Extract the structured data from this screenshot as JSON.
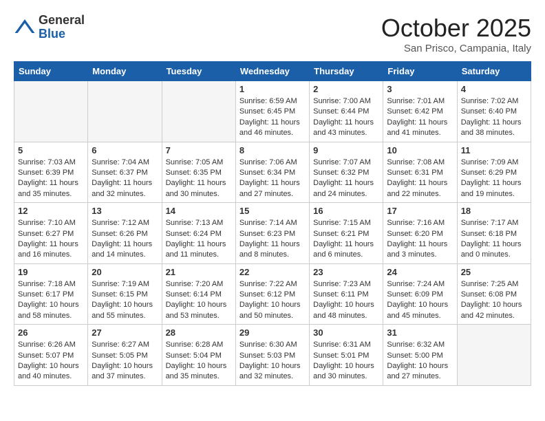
{
  "header": {
    "logo_general": "General",
    "logo_blue": "Blue",
    "month_title": "October 2025",
    "location": "San Prisco, Campania, Italy"
  },
  "days_of_week": [
    "Sunday",
    "Monday",
    "Tuesday",
    "Wednesday",
    "Thursday",
    "Friday",
    "Saturday"
  ],
  "weeks": [
    [
      {
        "day": "",
        "content": "",
        "empty": true
      },
      {
        "day": "",
        "content": "",
        "empty": true
      },
      {
        "day": "",
        "content": "",
        "empty": true
      },
      {
        "day": "1",
        "content": "Sunrise: 6:59 AM\nSunset: 6:45 PM\nDaylight: 11 hours\nand 46 minutes.",
        "empty": false
      },
      {
        "day": "2",
        "content": "Sunrise: 7:00 AM\nSunset: 6:44 PM\nDaylight: 11 hours\nand 43 minutes.",
        "empty": false
      },
      {
        "day": "3",
        "content": "Sunrise: 7:01 AM\nSunset: 6:42 PM\nDaylight: 11 hours\nand 41 minutes.",
        "empty": false
      },
      {
        "day": "4",
        "content": "Sunrise: 7:02 AM\nSunset: 6:40 PM\nDaylight: 11 hours\nand 38 minutes.",
        "empty": false
      }
    ],
    [
      {
        "day": "5",
        "content": "Sunrise: 7:03 AM\nSunset: 6:39 PM\nDaylight: 11 hours\nand 35 minutes.",
        "empty": false
      },
      {
        "day": "6",
        "content": "Sunrise: 7:04 AM\nSunset: 6:37 PM\nDaylight: 11 hours\nand 32 minutes.",
        "empty": false
      },
      {
        "day": "7",
        "content": "Sunrise: 7:05 AM\nSunset: 6:35 PM\nDaylight: 11 hours\nand 30 minutes.",
        "empty": false
      },
      {
        "day": "8",
        "content": "Sunrise: 7:06 AM\nSunset: 6:34 PM\nDaylight: 11 hours\nand 27 minutes.",
        "empty": false
      },
      {
        "day": "9",
        "content": "Sunrise: 7:07 AM\nSunset: 6:32 PM\nDaylight: 11 hours\nand 24 minutes.",
        "empty": false
      },
      {
        "day": "10",
        "content": "Sunrise: 7:08 AM\nSunset: 6:31 PM\nDaylight: 11 hours\nand 22 minutes.",
        "empty": false
      },
      {
        "day": "11",
        "content": "Sunrise: 7:09 AM\nSunset: 6:29 PM\nDaylight: 11 hours\nand 19 minutes.",
        "empty": false
      }
    ],
    [
      {
        "day": "12",
        "content": "Sunrise: 7:10 AM\nSunset: 6:27 PM\nDaylight: 11 hours\nand 16 minutes.",
        "empty": false
      },
      {
        "day": "13",
        "content": "Sunrise: 7:12 AM\nSunset: 6:26 PM\nDaylight: 11 hours\nand 14 minutes.",
        "empty": false
      },
      {
        "day": "14",
        "content": "Sunrise: 7:13 AM\nSunset: 6:24 PM\nDaylight: 11 hours\nand 11 minutes.",
        "empty": false
      },
      {
        "day": "15",
        "content": "Sunrise: 7:14 AM\nSunset: 6:23 PM\nDaylight: 11 hours\nand 8 minutes.",
        "empty": false
      },
      {
        "day": "16",
        "content": "Sunrise: 7:15 AM\nSunset: 6:21 PM\nDaylight: 11 hours\nand 6 minutes.",
        "empty": false
      },
      {
        "day": "17",
        "content": "Sunrise: 7:16 AM\nSunset: 6:20 PM\nDaylight: 11 hours\nand 3 minutes.",
        "empty": false
      },
      {
        "day": "18",
        "content": "Sunrise: 7:17 AM\nSunset: 6:18 PM\nDaylight: 11 hours\nand 0 minutes.",
        "empty": false
      }
    ],
    [
      {
        "day": "19",
        "content": "Sunrise: 7:18 AM\nSunset: 6:17 PM\nDaylight: 10 hours\nand 58 minutes.",
        "empty": false
      },
      {
        "day": "20",
        "content": "Sunrise: 7:19 AM\nSunset: 6:15 PM\nDaylight: 10 hours\nand 55 minutes.",
        "empty": false
      },
      {
        "day": "21",
        "content": "Sunrise: 7:20 AM\nSunset: 6:14 PM\nDaylight: 10 hours\nand 53 minutes.",
        "empty": false
      },
      {
        "day": "22",
        "content": "Sunrise: 7:22 AM\nSunset: 6:12 PM\nDaylight: 10 hours\nand 50 minutes.",
        "empty": false
      },
      {
        "day": "23",
        "content": "Sunrise: 7:23 AM\nSunset: 6:11 PM\nDaylight: 10 hours\nand 48 minutes.",
        "empty": false
      },
      {
        "day": "24",
        "content": "Sunrise: 7:24 AM\nSunset: 6:09 PM\nDaylight: 10 hours\nand 45 minutes.",
        "empty": false
      },
      {
        "day": "25",
        "content": "Sunrise: 7:25 AM\nSunset: 6:08 PM\nDaylight: 10 hours\nand 42 minutes.",
        "empty": false
      }
    ],
    [
      {
        "day": "26",
        "content": "Sunrise: 6:26 AM\nSunset: 5:07 PM\nDaylight: 10 hours\nand 40 minutes.",
        "empty": false
      },
      {
        "day": "27",
        "content": "Sunrise: 6:27 AM\nSunset: 5:05 PM\nDaylight: 10 hours\nand 37 minutes.",
        "empty": false
      },
      {
        "day": "28",
        "content": "Sunrise: 6:28 AM\nSunset: 5:04 PM\nDaylight: 10 hours\nand 35 minutes.",
        "empty": false
      },
      {
        "day": "29",
        "content": "Sunrise: 6:30 AM\nSunset: 5:03 PM\nDaylight: 10 hours\nand 32 minutes.",
        "empty": false
      },
      {
        "day": "30",
        "content": "Sunrise: 6:31 AM\nSunset: 5:01 PM\nDaylight: 10 hours\nand 30 minutes.",
        "empty": false
      },
      {
        "day": "31",
        "content": "Sunrise: 6:32 AM\nSunset: 5:00 PM\nDaylight: 10 hours\nand 27 minutes.",
        "empty": false
      },
      {
        "day": "",
        "content": "",
        "empty": true
      }
    ]
  ]
}
